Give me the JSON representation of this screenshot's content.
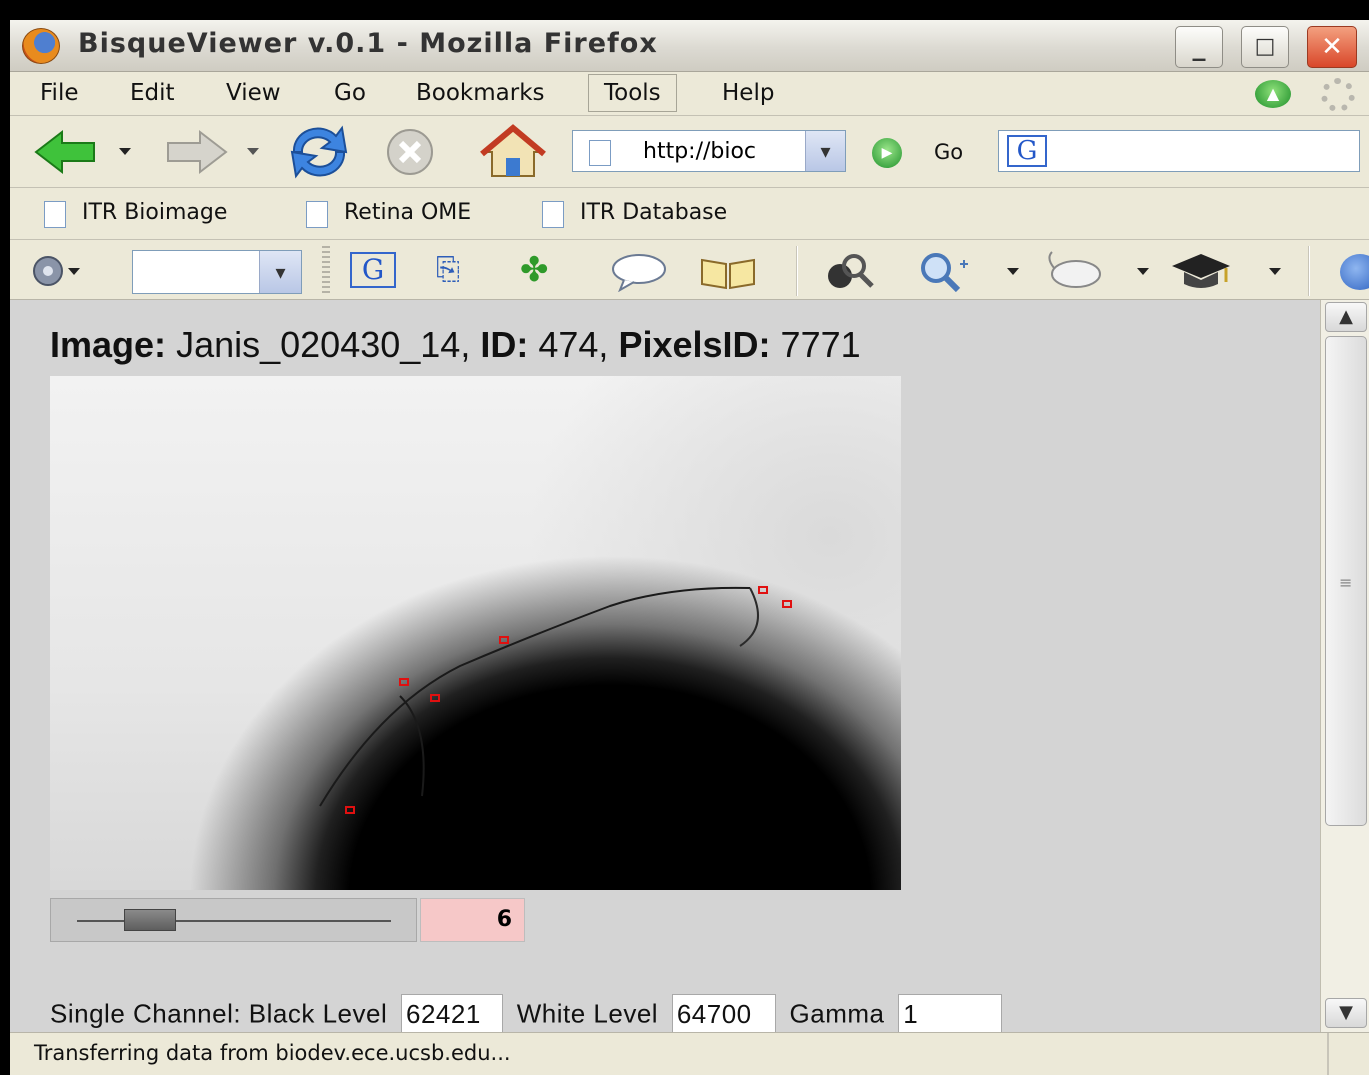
{
  "window": {
    "title": "BisqueViewer v.0.1 - Mozilla Firefox",
    "controls": {
      "minimize": "_",
      "maximize": "□",
      "close": "✕"
    }
  },
  "menubar": {
    "items": [
      {
        "label": "File"
      },
      {
        "label": "Edit"
      },
      {
        "label": "View"
      },
      {
        "label": "Go"
      },
      {
        "label": "Bookmarks"
      },
      {
        "label": "Tools"
      },
      {
        "label": "Help"
      }
    ]
  },
  "navbar": {
    "url": "http://bioc",
    "go_label": "Go",
    "search_engine": "G"
  },
  "bookmarks": {
    "items": [
      {
        "label": "ITR Bioimage"
      },
      {
        "label": "Retina OME"
      },
      {
        "label": "ITR Database"
      }
    ]
  },
  "toolbar2": {
    "google_label": "G"
  },
  "page": {
    "heading": {
      "image_label": "Image:",
      "image_name": "Janis_020430_14,",
      "id_label": "ID:",
      "id_value": "474,",
      "pixels_label": "PixelsID:",
      "pixels_value": "7771"
    },
    "slider": {
      "value": "6",
      "position": 0.18
    },
    "levels": {
      "prefix": "Single Channel: Black Level",
      "black_level": "62421",
      "white_label": "White Level",
      "white_level": "64700",
      "gamma_label": "Gamma",
      "gamma": "1"
    }
  },
  "status": {
    "text": "Transferring data from biodev.ece.ucsb.edu..."
  },
  "colors": {
    "marker": "#e01010",
    "slider_value_bg": "#f6c8c8",
    "chrome": "#ece9d8"
  }
}
